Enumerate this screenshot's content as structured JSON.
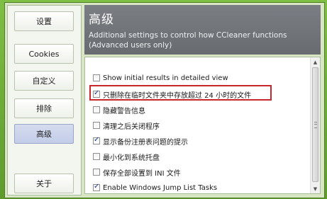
{
  "sidebar": {
    "items": [
      {
        "label": "设置"
      },
      {
        "label": "Cookies"
      },
      {
        "label": "自定义"
      },
      {
        "label": "排除"
      },
      {
        "label": "高级",
        "active": true
      },
      {
        "label": "关于"
      }
    ]
  },
  "header": {
    "title": "高级",
    "subtitle": "Additional settings to control how CCleaner functions (Advanced users only)"
  },
  "options": [
    {
      "label": "Show initial results in detailed view",
      "checked": false
    },
    {
      "label": "只删除在临时文件夹中存放超过 24 小时的文件",
      "checked": true,
      "highlighted": true
    },
    {
      "label": "隐藏警告信息",
      "checked": false
    },
    {
      "label": "清理之后关闭程序",
      "checked": false
    },
    {
      "label": "显示备份注册表问题的提示",
      "checked": true
    },
    {
      "label": "最小化到系统托盘",
      "checked": false
    },
    {
      "label": "保存全部设置到 INI 文件",
      "checked": false
    },
    {
      "label": "Enable Windows Jump List Tasks",
      "checked": true
    }
  ],
  "colors": {
    "highlight_border": "#c8282c",
    "header_bg": "#6f7378",
    "active_tab": "#c9d2ea"
  }
}
